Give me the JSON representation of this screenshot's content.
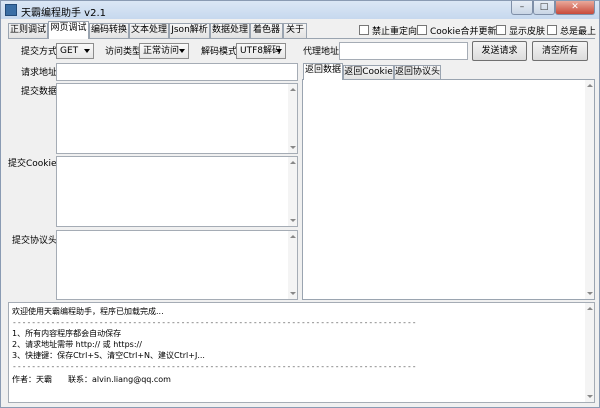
{
  "window": {
    "title": "天霸编程助手 v2.1",
    "controls": {
      "minimize": "–",
      "maximize": "□",
      "close": "✕"
    }
  },
  "tabs": [
    {
      "label": "正则调试",
      "active": false
    },
    {
      "label": "网页调试",
      "active": true
    },
    {
      "label": "编码转换",
      "active": false
    },
    {
      "label": "文本处理",
      "active": false
    },
    {
      "label": "Json解析",
      "active": false
    },
    {
      "label": "数据处理",
      "active": false
    },
    {
      "label": "着色器",
      "active": false
    },
    {
      "label": "关于",
      "active": false
    }
  ],
  "options": [
    {
      "label": "禁止重定向",
      "checked": false
    },
    {
      "label": "Cookie合并更新",
      "checked": false
    },
    {
      "label": "显示皮肤",
      "checked": false
    },
    {
      "label": "总是最上",
      "checked": false
    }
  ],
  "request": {
    "method_label": "提交方式",
    "method_value": "GET",
    "access_label": "访问类型",
    "access_value": "正常访问",
    "decode_label": "解码模式",
    "decode_value": "UTF8解码",
    "proxy_label": "代理地址",
    "proxy_value": "",
    "send_button": "发送请求",
    "clear_button": "清空所有",
    "url_label": "请求地址",
    "url_value": "",
    "data_label": "提交数据",
    "cookie_label": "提交Cookie",
    "headers_label": "提交协议头"
  },
  "response_tabs": [
    {
      "label": "返回数据",
      "active": true
    },
    {
      "label": "返回Cookie",
      "active": false
    },
    {
      "label": "返回协议头",
      "active": false
    }
  ],
  "log": {
    "welcome": "欢迎使用天霸编程助手，程序已加载完成...",
    "separator": "------------------------------------------------------------------------------------",
    "tip1": "1、所有内容程序都会自动保存",
    "tip2": "2、请求地址需带 http:// 或 https://",
    "tip3": "3、快捷键：保存Ctrl+S、清空Ctrl+N、建议Ctrl+J...",
    "author": "作者：天霸　　联系：alvin.liang@qq.com"
  },
  "colors": {
    "titlebar": "#c6d8ee",
    "close_button": "#c84a3a",
    "panel_bg": "#f0f0f0",
    "field_bg": "#ffffff"
  }
}
